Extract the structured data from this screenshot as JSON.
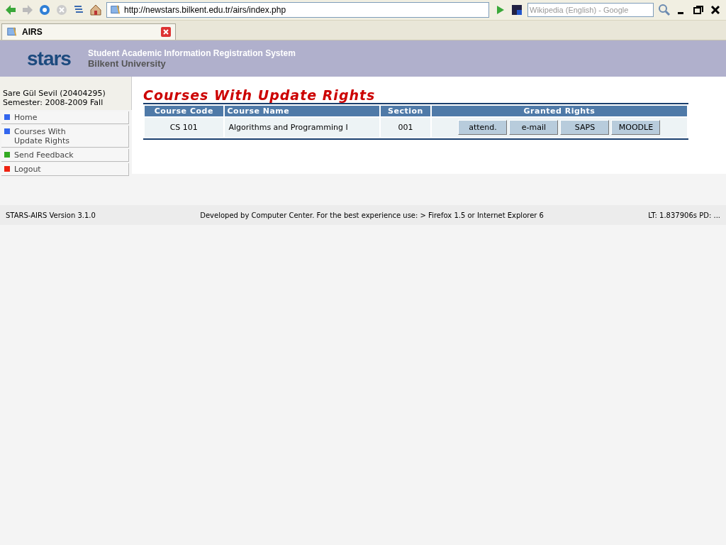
{
  "browser": {
    "address": "http://newstars.bilkent.edu.tr/airs/index.php",
    "search_placeholder": "Wikipedia (English) - Google",
    "tabs": [
      {
        "label": "AIRS",
        "selected": true
      }
    ]
  },
  "header": {
    "logo": "stars",
    "title": "Student Academic Information Registration System",
    "subtitle": "Bilkent University"
  },
  "sidebar": {
    "user": "Sare Gül Sevil (20404295)",
    "semester": "Semester: 2008-2009 Fall",
    "items": [
      {
        "label": "Home",
        "color": "#3366ee"
      },
      {
        "label": "Courses With\nUpdate Rights",
        "color": "#3366ee"
      },
      {
        "label": "Send Feedback",
        "color": "#33aa22"
      },
      {
        "label": "Logout",
        "color": "#ee2211"
      }
    ]
  },
  "page_title": "Courses With Update Rights",
  "table": {
    "columns": [
      "Course Code",
      "Course Name",
      "Section",
      "Granted Rights"
    ],
    "rows": [
      {
        "code": "CS 101",
        "name": "Algorithms and Programming I",
        "section": "001",
        "rights": [
          "attend.",
          "e-mail",
          "SAPS",
          "MOODLE"
        ]
      }
    ]
  },
  "footer": {
    "version": "STARS-AIRS Version 3.1.0",
    "credits": "Developed by Computer Center. For the best experience use: > Firefox 1.5 or Internet Explorer 6",
    "timing": "LT: 1.837906s PD: ..."
  }
}
